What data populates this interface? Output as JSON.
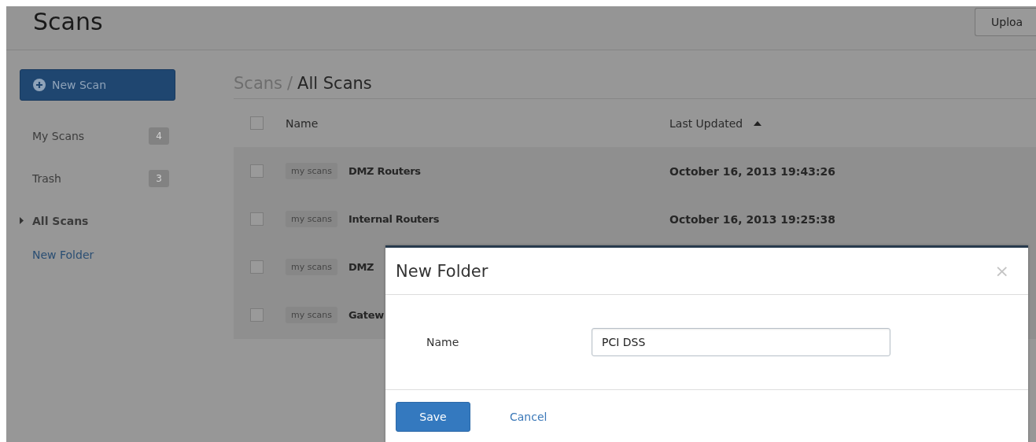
{
  "header": {
    "title": "Scans",
    "upload_button": "Uploa"
  },
  "sidebar": {
    "new_scan_button": "New Scan",
    "items": [
      {
        "label": "My Scans",
        "count": "4",
        "selected": false
      },
      {
        "label": "Trash",
        "count": "3",
        "selected": false
      },
      {
        "label": "All Scans",
        "selected": true
      }
    ],
    "new_folder_link": "New Folder"
  },
  "breadcrumb": {
    "parent": "Scans",
    "separator": "/",
    "current": "All Scans"
  },
  "table": {
    "select_all_checked": false,
    "columns": [
      {
        "label": "Name"
      },
      {
        "label": "Last Updated",
        "sort_ascending": true
      }
    ],
    "rows": [
      {
        "checked": false,
        "tag": "my scans",
        "name": "DMZ Routers",
        "updated": "October 16, 2013 19:43:26"
      },
      {
        "checked": false,
        "tag": "my scans",
        "name": "Internal Routers",
        "updated": "October 16, 2013 19:25:38"
      },
      {
        "checked": false,
        "tag": "my scans",
        "name": "DMZ"
      },
      {
        "checked": false,
        "tag": "my scans",
        "name": "Gatew"
      }
    ]
  },
  "dialog": {
    "title": "New Folder",
    "close": "×",
    "field_label": "Name",
    "field_value": "PCI DSS",
    "save_button": "Save",
    "cancel_link": "Cancel"
  }
}
